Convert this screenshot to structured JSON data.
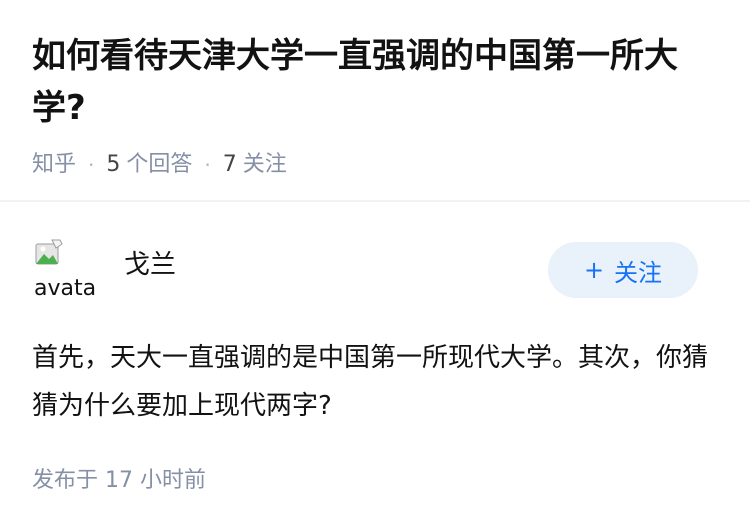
{
  "question": {
    "title": "如何看待天津大学一直强调的中国第一所大学?",
    "source": "知乎",
    "answers_count": "5",
    "answers_label": "个回答",
    "followers_count": "7",
    "followers_label": "关注"
  },
  "answer": {
    "author": {
      "name": "戈兰",
      "avatar_alt": "avatar",
      "avatar_icon": "broken-image-icon"
    },
    "follow_button": {
      "plus": "+",
      "label": "关注"
    },
    "content": "首先，天大一直强调的是中国第一所现代大学。其次，你猜猜为什么要加上现代两字?",
    "time": "发布于 17 小时前"
  },
  "colors": {
    "text": "#121212",
    "meta": "#8590a6",
    "accent": "#1772f6",
    "follow_bg": "#e9f1fa"
  }
}
